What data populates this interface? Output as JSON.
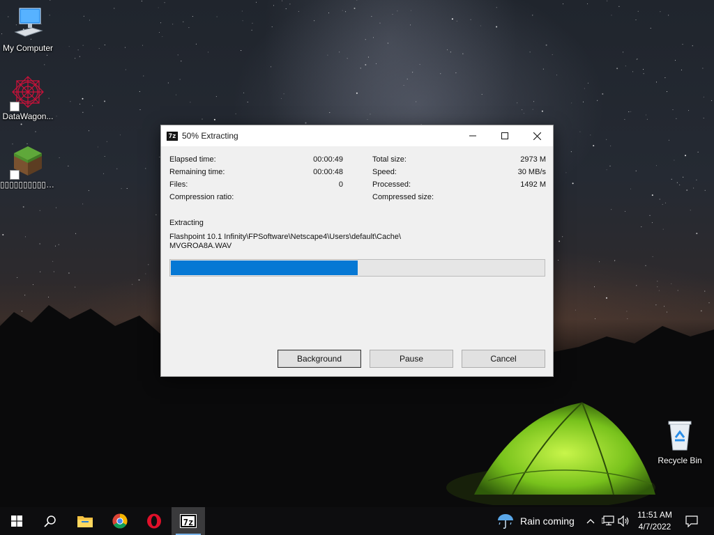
{
  "desktop": {
    "icons": [
      {
        "label": "My Computer",
        "icon": "computer-icon"
      },
      {
        "label": "DataWagon...",
        "icon": "datawagon-icon"
      },
      {
        "label": "▯▯▯▯▯▯▯▯▯▯▯▯▯...",
        "icon": "minecraft-block-icon"
      },
      {
        "label": "Recycle Bin",
        "icon": "recycle-bin-icon"
      }
    ]
  },
  "dialog": {
    "title": "50% Extracting",
    "app_icon_text": "7z",
    "stats": {
      "elapsed_label": "Elapsed time:",
      "elapsed_value": "00:00:49",
      "remaining_label": "Remaining time:",
      "remaining_value": "00:00:48",
      "files_label": "Files:",
      "files_value": "0",
      "ratio_label": "Compression ratio:",
      "ratio_value": "",
      "total_label": "Total size:",
      "total_value": "2973 M",
      "speed_label": "Speed:",
      "speed_value": "30 MB/s",
      "processed_label": "Processed:",
      "processed_value": "1492 M",
      "compressed_label": "Compressed size:",
      "compressed_value": ""
    },
    "section_label": "Extracting",
    "path_line1": "Flashpoint 10.1 Infinity\\FPSoftware\\Netscape4\\Users\\default\\Cache\\",
    "path_line2": "MVGROA8A.WAV",
    "progress_percent": 50,
    "buttons": {
      "background": "Background",
      "pause": "Pause",
      "cancel": "Cancel"
    }
  },
  "taskbar": {
    "pinned": [
      "windows-start-icon",
      "search-icon",
      "file-explorer-icon",
      "chrome-icon",
      "opera-icon",
      "7zip-icon"
    ],
    "active_app_text": "7z",
    "weather": "Rain coming",
    "time": "11:51 AM",
    "date": "4/7/2022"
  },
  "colors": {
    "accent": "#0678d4",
    "taskbar": "#0d0d0f",
    "dialog_bg": "#f0f0f0"
  }
}
